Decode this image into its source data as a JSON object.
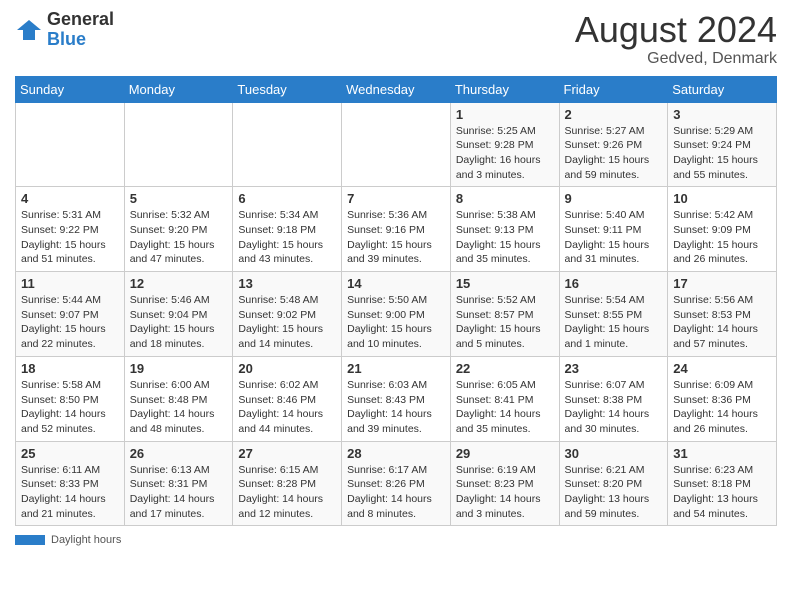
{
  "header": {
    "logo_general": "General",
    "logo_blue": "Blue",
    "month_year": "August 2024",
    "location": "Gedved, Denmark"
  },
  "days_of_week": [
    "Sunday",
    "Monday",
    "Tuesday",
    "Wednesday",
    "Thursday",
    "Friday",
    "Saturday"
  ],
  "footer": {
    "label": "Daylight hours"
  },
  "weeks": [
    [
      {
        "day": "",
        "info": ""
      },
      {
        "day": "",
        "info": ""
      },
      {
        "day": "",
        "info": ""
      },
      {
        "day": "",
        "info": ""
      },
      {
        "day": "1",
        "info": "Sunrise: 5:25 AM\nSunset: 9:28 PM\nDaylight: 16 hours\nand 3 minutes."
      },
      {
        "day": "2",
        "info": "Sunrise: 5:27 AM\nSunset: 9:26 PM\nDaylight: 15 hours\nand 59 minutes."
      },
      {
        "day": "3",
        "info": "Sunrise: 5:29 AM\nSunset: 9:24 PM\nDaylight: 15 hours\nand 55 minutes."
      }
    ],
    [
      {
        "day": "4",
        "info": "Sunrise: 5:31 AM\nSunset: 9:22 PM\nDaylight: 15 hours\nand 51 minutes."
      },
      {
        "day": "5",
        "info": "Sunrise: 5:32 AM\nSunset: 9:20 PM\nDaylight: 15 hours\nand 47 minutes."
      },
      {
        "day": "6",
        "info": "Sunrise: 5:34 AM\nSunset: 9:18 PM\nDaylight: 15 hours\nand 43 minutes."
      },
      {
        "day": "7",
        "info": "Sunrise: 5:36 AM\nSunset: 9:16 PM\nDaylight: 15 hours\nand 39 minutes."
      },
      {
        "day": "8",
        "info": "Sunrise: 5:38 AM\nSunset: 9:13 PM\nDaylight: 15 hours\nand 35 minutes."
      },
      {
        "day": "9",
        "info": "Sunrise: 5:40 AM\nSunset: 9:11 PM\nDaylight: 15 hours\nand 31 minutes."
      },
      {
        "day": "10",
        "info": "Sunrise: 5:42 AM\nSunset: 9:09 PM\nDaylight: 15 hours\nand 26 minutes."
      }
    ],
    [
      {
        "day": "11",
        "info": "Sunrise: 5:44 AM\nSunset: 9:07 PM\nDaylight: 15 hours\nand 22 minutes."
      },
      {
        "day": "12",
        "info": "Sunrise: 5:46 AM\nSunset: 9:04 PM\nDaylight: 15 hours\nand 18 minutes."
      },
      {
        "day": "13",
        "info": "Sunrise: 5:48 AM\nSunset: 9:02 PM\nDaylight: 15 hours\nand 14 minutes."
      },
      {
        "day": "14",
        "info": "Sunrise: 5:50 AM\nSunset: 9:00 PM\nDaylight: 15 hours\nand 10 minutes."
      },
      {
        "day": "15",
        "info": "Sunrise: 5:52 AM\nSunset: 8:57 PM\nDaylight: 15 hours\nand 5 minutes."
      },
      {
        "day": "16",
        "info": "Sunrise: 5:54 AM\nSunset: 8:55 PM\nDaylight: 15 hours\nand 1 minute."
      },
      {
        "day": "17",
        "info": "Sunrise: 5:56 AM\nSunset: 8:53 PM\nDaylight: 14 hours\nand 57 minutes."
      }
    ],
    [
      {
        "day": "18",
        "info": "Sunrise: 5:58 AM\nSunset: 8:50 PM\nDaylight: 14 hours\nand 52 minutes."
      },
      {
        "day": "19",
        "info": "Sunrise: 6:00 AM\nSunset: 8:48 PM\nDaylight: 14 hours\nand 48 minutes."
      },
      {
        "day": "20",
        "info": "Sunrise: 6:02 AM\nSunset: 8:46 PM\nDaylight: 14 hours\nand 44 minutes."
      },
      {
        "day": "21",
        "info": "Sunrise: 6:03 AM\nSunset: 8:43 PM\nDaylight: 14 hours\nand 39 minutes."
      },
      {
        "day": "22",
        "info": "Sunrise: 6:05 AM\nSunset: 8:41 PM\nDaylight: 14 hours\nand 35 minutes."
      },
      {
        "day": "23",
        "info": "Sunrise: 6:07 AM\nSunset: 8:38 PM\nDaylight: 14 hours\nand 30 minutes."
      },
      {
        "day": "24",
        "info": "Sunrise: 6:09 AM\nSunset: 8:36 PM\nDaylight: 14 hours\nand 26 minutes."
      }
    ],
    [
      {
        "day": "25",
        "info": "Sunrise: 6:11 AM\nSunset: 8:33 PM\nDaylight: 14 hours\nand 21 minutes."
      },
      {
        "day": "26",
        "info": "Sunrise: 6:13 AM\nSunset: 8:31 PM\nDaylight: 14 hours\nand 17 minutes."
      },
      {
        "day": "27",
        "info": "Sunrise: 6:15 AM\nSunset: 8:28 PM\nDaylight: 14 hours\nand 12 minutes."
      },
      {
        "day": "28",
        "info": "Sunrise: 6:17 AM\nSunset: 8:26 PM\nDaylight: 14 hours\nand 8 minutes."
      },
      {
        "day": "29",
        "info": "Sunrise: 6:19 AM\nSunset: 8:23 PM\nDaylight: 14 hours\nand 3 minutes."
      },
      {
        "day": "30",
        "info": "Sunrise: 6:21 AM\nSunset: 8:20 PM\nDaylight: 13 hours\nand 59 minutes."
      },
      {
        "day": "31",
        "info": "Sunrise: 6:23 AM\nSunset: 8:18 PM\nDaylight: 13 hours\nand 54 minutes."
      }
    ]
  ]
}
